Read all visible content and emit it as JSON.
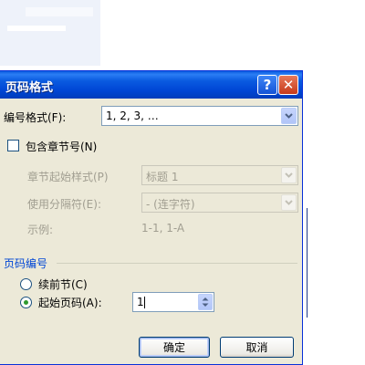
{
  "dialog": {
    "title": "页码格式",
    "help_glyph": "?",
    "close_glyph": "✕"
  },
  "number_format": {
    "label": "编号格式(F):",
    "value": "1, 2, 3, …"
  },
  "include_chapter": {
    "label": "包含章节号(N)",
    "checked": false
  },
  "chapter_style": {
    "label": "章节起始样式(P)",
    "value": "标题 1"
  },
  "separator": {
    "label": "使用分隔符(E):",
    "value": "-   (连字符)"
  },
  "example": {
    "label": "示例:",
    "value": "1-1, 1-A"
  },
  "page_numbering": {
    "group_title": "页码编号",
    "continue_label": "续前节(C)",
    "start_label": "起始页码(A):",
    "start_value": "1",
    "selected": "start"
  },
  "buttons": {
    "ok": "确定",
    "cancel": "取消"
  },
  "colors": {
    "titlebar": "#0a5be0",
    "dialog_bg": "#ece9d8",
    "group_title": "#0046d5"
  }
}
